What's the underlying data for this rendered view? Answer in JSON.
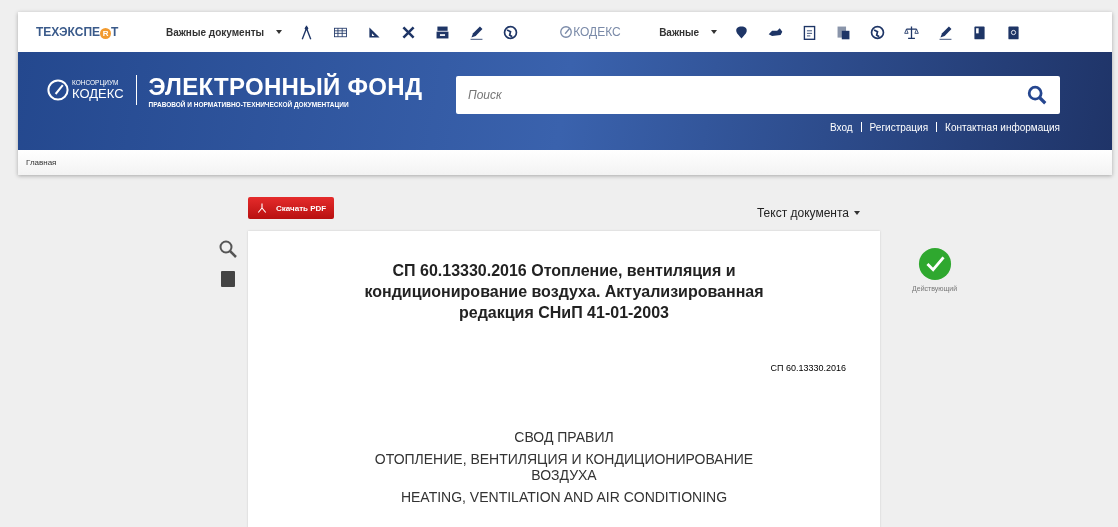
{
  "toolbar": {
    "left_logo": {
      "before": "ТЕХЭКСПЕ",
      "mark": "R",
      "after": "Т"
    },
    "left_menu": "Важные документы",
    "right_logo": "КОДЕКС",
    "right_menu": "Важные"
  },
  "banner": {
    "logo_top": "КОНСОРЦИУМ",
    "logo_main": "КОДЕКС",
    "title": "ЭЛЕКТРОННЫЙ ФОНД",
    "subtitle": "ПРАВОВОЙ И НОРМАТИВНО-ТЕХНИЧЕСКОЙ ДОКУМЕНТАЦИИ",
    "search": {
      "placeholder": "Поиск"
    },
    "links": [
      "Вход",
      "Регистрация",
      "Контактная информация"
    ]
  },
  "breadcrumb": "Главная",
  "pdf_button": "Скачать PDF",
  "view_menu": "Текст документа",
  "status": {
    "kind": "active",
    "label": "Действующий"
  },
  "document": {
    "title": "СП 60.13330.2016 Отопление, вентиляция и кондиционирование воздуха. Актуализированная редакция СНиП 41-01-2003",
    "code": "СП 60.13330.2016",
    "lines": [
      "СВОД ПРАВИЛ",
      "ОТОПЛЕНИЕ, ВЕНТИЛЯЦИЯ И КОНДИЦИОНИРОВАНИЕ ВОЗДУХА",
      "HEATING, VENTILATION AND AIR CONDITIONING"
    ]
  }
}
